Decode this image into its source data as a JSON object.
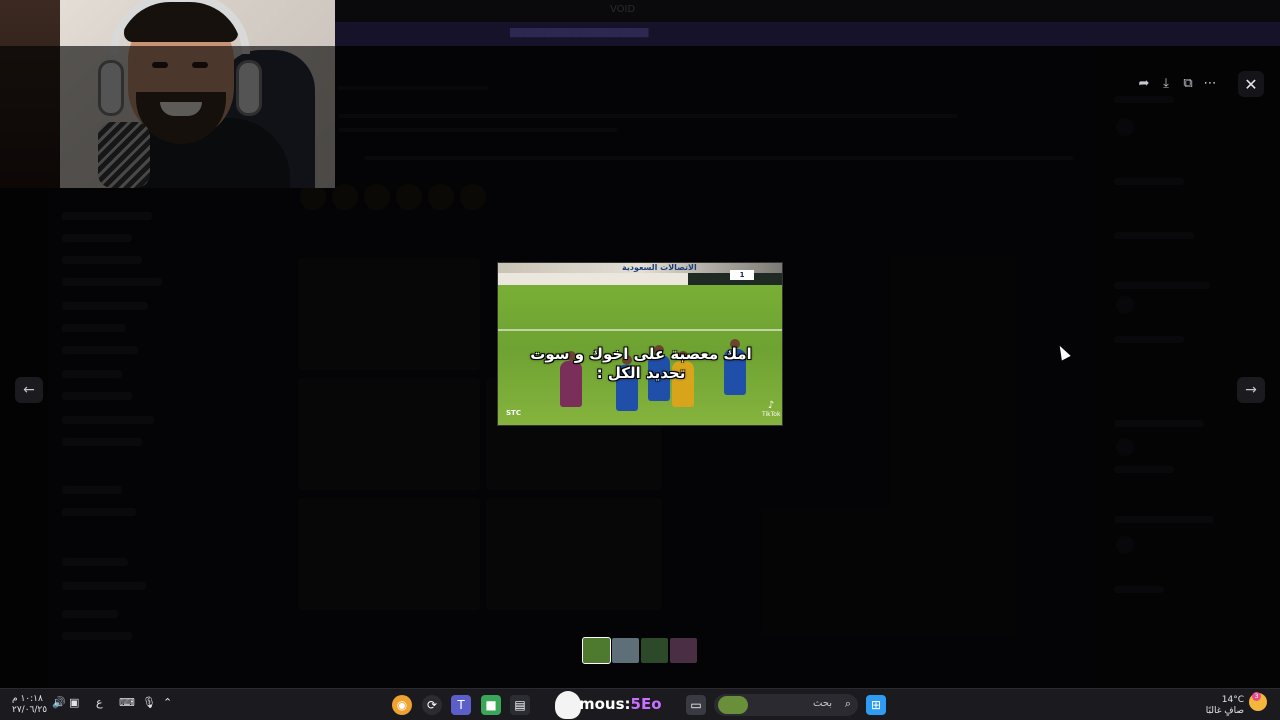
{
  "app": {
    "window_title": "VOID"
  },
  "media": {
    "caption_line1": "امك معصبة على اخوك و سوت",
    "caption_line2": "تحديد الكل :",
    "score_badge": "1",
    "board_text": "الاتصالات السعودية",
    "stc_text": "STC",
    "tiktok_label": "TikTok"
  },
  "viewer": {
    "actions": [
      "forward-icon",
      "download-icon",
      "open-external-icon",
      "more-icon"
    ],
    "close": "close-icon",
    "prev": "arrow-left-icon",
    "next": "arrow-right-icon"
  },
  "thumbnails": [
    {
      "color": "#4d7a2e",
      "active": true
    },
    {
      "color": "#5e6f79",
      "active": false
    },
    {
      "color": "#2c4a2a",
      "active": false
    },
    {
      "color": "#4a2f44",
      "active": false
    }
  ],
  "taskbar": {
    "time": "١٠:١٨ م",
    "date": "٢٧/٠٦/٢٥",
    "keyboard_lang": "ع",
    "search_placeholder": "بحث",
    "stream_text_a": "mous:",
    "stream_text_b": "5Eo",
    "weather_temp": "14°C",
    "weather_desc": "صافٍ غالبًا",
    "notification_count": "3"
  },
  "colors": {
    "accent_purple": "#c870ff",
    "win_blue": "#2f9cf4",
    "hilal_blue": "#1f4fa8"
  }
}
